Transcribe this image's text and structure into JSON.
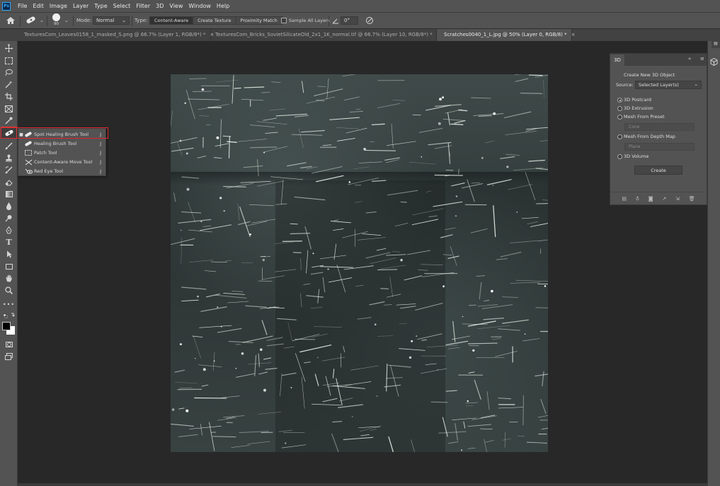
{
  "app": {
    "logo": "Ps"
  },
  "menu": [
    "File",
    "Edit",
    "Image",
    "Layer",
    "Type",
    "Select",
    "Filter",
    "3D",
    "View",
    "Window",
    "Help"
  ],
  "options": {
    "brush_size": "90",
    "mode_label": "Mode:",
    "mode_value": "Normal",
    "type_label": "Type:",
    "type_options": [
      "Content-Aware",
      "Create Texture",
      "Proximity Match"
    ],
    "sample_all_layers": "Sample All Layers",
    "angle": "0°"
  },
  "tabs": [
    {
      "label": "TexturesCom_Leaves0158_1_masked_S.png @ 66.7% (Layer 1, RGB/8*) *"
    },
    {
      "label": "TexturesCom_Bricks_SovietSilicateOld_2x1_1K_normal.tif @ 66.7% (Layer 10, RGB/8*) *"
    },
    {
      "label": "Scratches0040_1_L.jpg @ 50% (Layer 0, RGB/8) *"
    }
  ],
  "flyout": {
    "items": [
      {
        "label": "Spot Healing Brush Tool",
        "key": "J",
        "selected": true
      },
      {
        "label": "Healing Brush Tool",
        "key": "J",
        "selected": false
      },
      {
        "label": "Patch Tool",
        "key": "J",
        "selected": false
      },
      {
        "label": "Content-Aware Move Tool",
        "key": "J",
        "selected": false
      },
      {
        "label": "Red Eye Tool",
        "key": "J",
        "selected": false
      }
    ]
  },
  "panel3d": {
    "tab": "3D",
    "create_title": "Create New 3D Object",
    "source_label": "Source:",
    "source_value": "Selected Layer(s)",
    "options": [
      "3D Postcard",
      "3D Extrusion",
      "Mesh From Preset",
      "Mesh From Depth Map",
      "3D Volume"
    ],
    "selected_option": "3D Postcard",
    "preset_value": "Cone",
    "depth_value": "Plane",
    "create_button": "Create"
  }
}
